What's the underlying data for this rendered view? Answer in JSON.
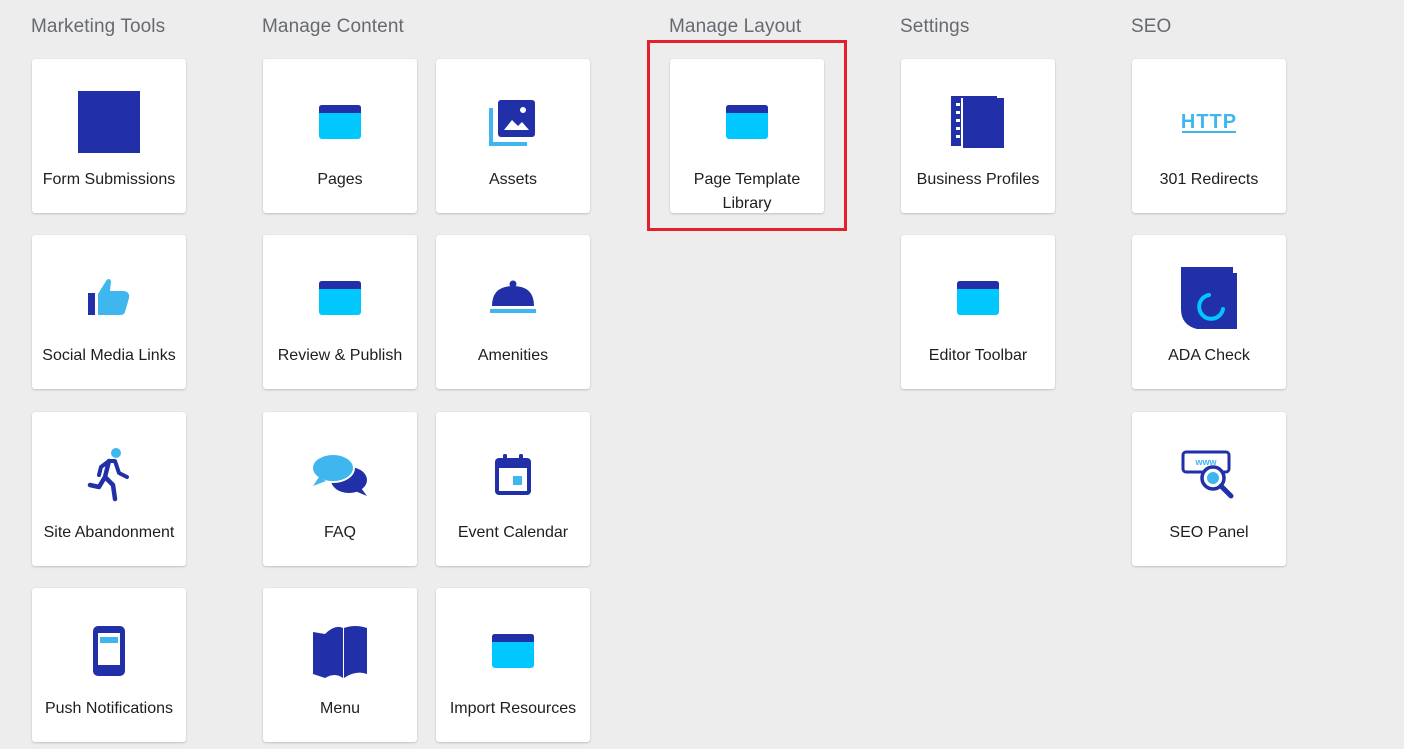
{
  "sections": {
    "marketing": {
      "title": "Marketing Tools",
      "tiles": [
        {
          "label": "Form Submissions",
          "icon": "form-submissions-icon"
        },
        {
          "label": "Social Media Links",
          "icon": "thumbs-up-icon"
        },
        {
          "label": "Site Abandonment",
          "icon": "running-person-icon"
        },
        {
          "label": "Push Notifications",
          "icon": "mobile-phone-icon"
        }
      ]
    },
    "content": {
      "title": "Manage Content",
      "tiles": [
        {
          "label": "Pages",
          "icon": "window-icon"
        },
        {
          "label": "Assets",
          "icon": "image-gallery-icon"
        },
        {
          "label": "Review & Publish",
          "icon": "window-icon"
        },
        {
          "label": "Amenities",
          "icon": "service-bell-icon"
        },
        {
          "label": "FAQ",
          "icon": "speech-bubbles-icon"
        },
        {
          "label": "Event Calendar",
          "icon": "calendar-icon"
        },
        {
          "label": "Menu",
          "icon": "open-book-icon"
        },
        {
          "label": "Import Resources",
          "icon": "window-icon"
        }
      ]
    },
    "layout": {
      "title": "Manage Layout",
      "tiles": [
        {
          "label": "Page Template Library",
          "icon": "window-icon"
        }
      ]
    },
    "settings": {
      "title": "Settings",
      "tiles": [
        {
          "label": "Business Profiles",
          "icon": "notebook-icon"
        },
        {
          "label": "Editor Toolbar",
          "icon": "window-icon"
        }
      ]
    },
    "seo": {
      "title": "SEO",
      "tiles": [
        {
          "label": "301 Redirects",
          "icon": "http-icon",
          "icon_text": "HTTP"
        },
        {
          "label": "ADA Check",
          "icon": "ada-check-icon"
        },
        {
          "label": "SEO Panel",
          "icon": "www-search-icon",
          "icon_text": "www"
        }
      ]
    }
  },
  "highlight": {
    "target": "Page Template Library"
  },
  "colors": {
    "dark_blue": "#2130a8",
    "light_blue": "#00c8ff",
    "sky_blue": "#3fb6ee",
    "highlight_red": "#e3202b",
    "background": "#ededed"
  }
}
